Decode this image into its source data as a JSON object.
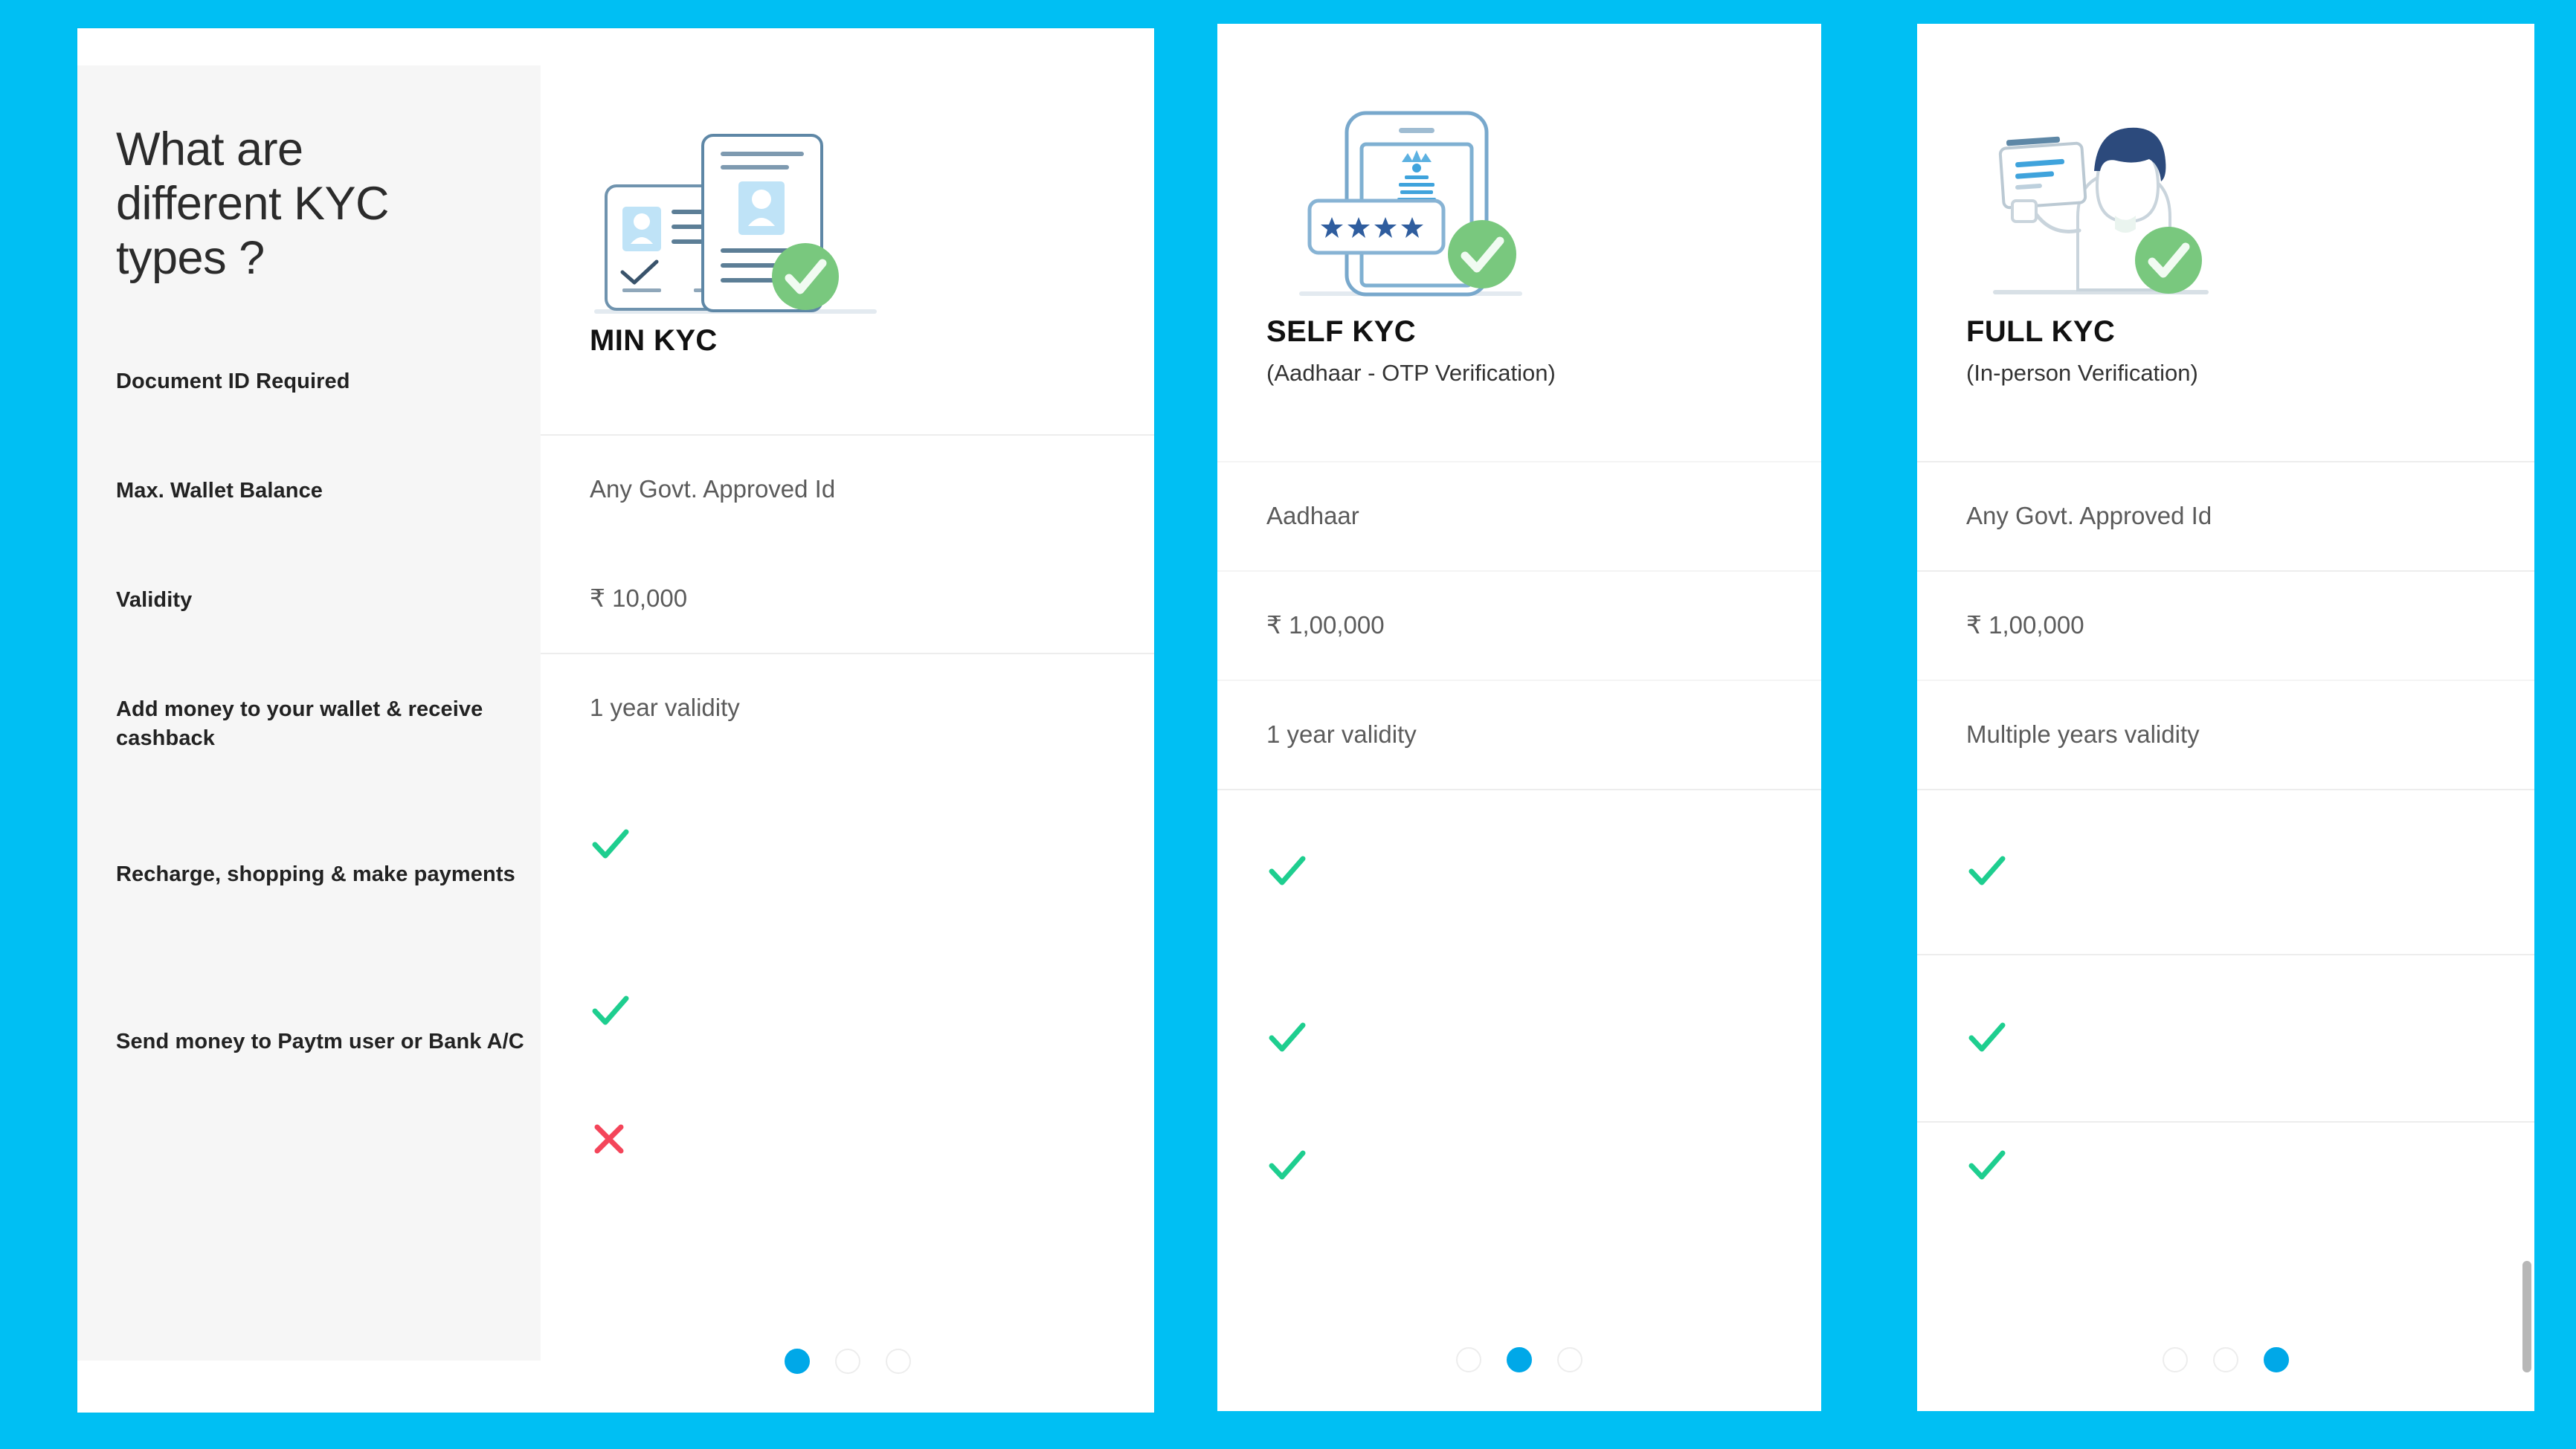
{
  "theme": {
    "page_background": "#00BFF3",
    "card_background": "#FFFFFF",
    "sidebar_background": "#F6F6F6",
    "accent_blue": "#00A8E8",
    "check_green": "#1ECE8F",
    "cross_red": "#F4455A",
    "divider": "#EDEDED"
  },
  "sidebar": {
    "heading": "What are different KYC types ?",
    "criteria": [
      "Document ID Required",
      "Max. Wallet Balance",
      "Validity",
      "Add money to your wallet & receive cashback",
      "Recharge, shopping & make payments",
      "Send money to Paytm user or Bank A/C"
    ]
  },
  "cards": [
    {
      "id": "min-kyc",
      "title": "MIN KYC",
      "subtitle": "",
      "illustration": "id-cards-verified-icon",
      "values": [
        {
          "type": "text",
          "text": "Any Govt. Approved Id"
        },
        {
          "type": "text",
          "text": "₹ 10,000"
        },
        {
          "type": "text",
          "text": "1 year validity"
        },
        {
          "type": "check",
          "text": ""
        },
        {
          "type": "check",
          "text": ""
        },
        {
          "type": "cross",
          "text": ""
        }
      ],
      "pagination": {
        "total": 3,
        "active_index": 0
      }
    },
    {
      "id": "self-kyc",
      "title": "SELF KYC",
      "subtitle": "(Aadhaar - OTP Verification)",
      "illustration": "phone-otp-verified-icon",
      "values": [
        {
          "type": "text",
          "text": "Aadhaar"
        },
        {
          "type": "text",
          "text": "₹ 1,00,000"
        },
        {
          "type": "text",
          "text": "1 year validity"
        },
        {
          "type": "check",
          "text": ""
        },
        {
          "type": "check",
          "text": ""
        },
        {
          "type": "check",
          "text": ""
        }
      ],
      "pagination": {
        "total": 3,
        "active_index": 1
      }
    },
    {
      "id": "full-kyc",
      "title": "FULL KYC",
      "subtitle": "(In-person Verification)",
      "illustration": "person-holding-id-verified-icon",
      "values": [
        {
          "type": "text",
          "text": "Any Govt. Approved Id"
        },
        {
          "type": "text",
          "text": "₹ 1,00,000"
        },
        {
          "type": "text",
          "text": "Multiple years validity"
        },
        {
          "type": "check",
          "text": ""
        },
        {
          "type": "check",
          "text": ""
        },
        {
          "type": "check",
          "text": ""
        }
      ],
      "pagination": {
        "total": 3,
        "active_index": 2
      }
    }
  ]
}
